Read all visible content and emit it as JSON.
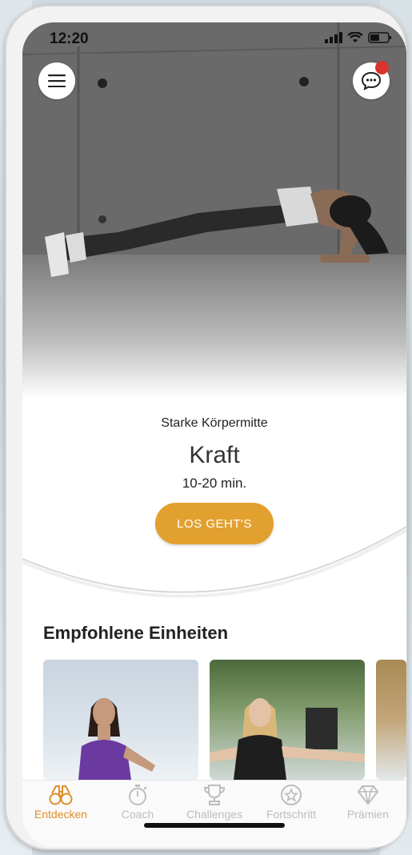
{
  "status_bar": {
    "time": "12:20"
  },
  "header": {
    "menu_icon": "hamburger-icon",
    "chat_icon": "chat-bubble-icon",
    "has_notification": true
  },
  "workout": {
    "subtitle": "Starke Körpermitte",
    "title": "Kraft",
    "duration": "10-20 min.",
    "cta_label": "LOS GEHT'S"
  },
  "recommended": {
    "heading": "Empfohlene Einheiten",
    "cards": [
      "card-1",
      "card-2",
      "card-3"
    ]
  },
  "tabbar": {
    "items": [
      {
        "label": "Entdecken",
        "icon": "binoculars-icon",
        "active": true
      },
      {
        "label": "Coach",
        "icon": "stopwatch-icon",
        "active": false
      },
      {
        "label": "Challenges",
        "icon": "trophy-icon",
        "active": false
      },
      {
        "label": "Fortschritt",
        "icon": "star-circle-icon",
        "active": false
      },
      {
        "label": "Prämien",
        "icon": "diamond-icon",
        "active": false
      }
    ]
  },
  "colors": {
    "accent": "#e2a12f",
    "active_tab": "#e08e2b",
    "inactive_tab": "#bdbdbd",
    "badge": "#d9342b"
  }
}
